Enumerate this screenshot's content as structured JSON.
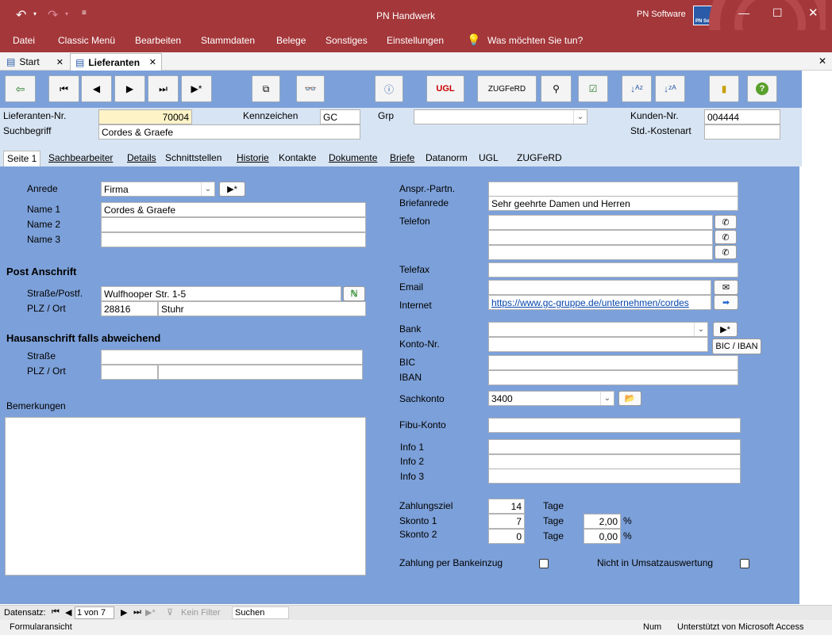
{
  "window": {
    "title": "PN Handwerk",
    "brand": "PN Software",
    "logo_text": "PN Soft"
  },
  "menu": [
    "Datei",
    "Classic Menü",
    "Bearbeiten",
    "Stammdaten",
    "Belege",
    "Sonstiges",
    "Einstellungen"
  ],
  "tell_me": "Was möchten Sie tun?",
  "doc_tabs": [
    {
      "label": "Start"
    },
    {
      "label": "Lieferanten"
    }
  ],
  "toolbar": {
    "ugl": "UGL",
    "zugferd": "ZUGFeRD"
  },
  "header": {
    "supplier_no_label": "Lieferanten-Nr.",
    "supplier_no": "70004",
    "search_label": "Suchbegriff",
    "search": "Cordes & Graefe",
    "code_label": "Kennzeichen",
    "code": "GC",
    "group_label": "Grp",
    "group": "",
    "customer_no_label": "Kunden-Nr.",
    "customer_no": "004444",
    "cost_type_label": "Std.-Kostenart",
    "cost_type": ""
  },
  "form_tabs": [
    "Seite 1",
    "Sachbearbeiter",
    "Details",
    "Schnittstellen",
    "Historie",
    "Kontakte",
    "Dokumente",
    "Briefe",
    "Datanorm",
    "UGL",
    "ZUGFeRD"
  ],
  "left": {
    "salutation_label": "Anrede",
    "salutation": "Firma",
    "name1_label": "Name 1",
    "name1": "Cordes & Graefe",
    "name2_label": "Name 2",
    "name2": "",
    "name3_label": "Name 3",
    "name3": "",
    "post_heading": "Post Anschrift",
    "street_label": "Straße/Postf.",
    "street": "Wulfhooper Str. 1-5",
    "zipcity_label": "PLZ / Ort",
    "zip": "28816",
    "city": "Stuhr",
    "house_heading": "Hausanschrift falls abweichend",
    "house_street_label": "Straße",
    "house_street": "",
    "house_zipcity_label": "PLZ / Ort",
    "house_zip": "",
    "house_city": "",
    "remarks_label": "Bemerkungen",
    "remarks": ""
  },
  "right": {
    "contact_label": "Anspr.-Partn.",
    "contact": "",
    "letter_label": "Briefanrede",
    "letter": "Sehr geehrte Damen und Herren",
    "phone_label": "Telefon",
    "phone1": "",
    "phone2": "",
    "phone3": "",
    "fax_label": "Telefax",
    "fax": "",
    "email_label": "Email",
    "email": "",
    "web_label": "Internet",
    "web": "https://www.gc-gruppe.de/unternehmen/cordes",
    "bank_label": "Bank",
    "bank": "",
    "account_label": "Konto-Nr.",
    "account": "",
    "bic_iban_button": "BIC / IBAN",
    "bic_label": "BIC",
    "bic": "",
    "iban_label": "IBAN",
    "iban": "",
    "ledger_label": "Sachkonto",
    "ledger": "3400",
    "fibu_label": "Fibu-Konto",
    "fibu": "",
    "info1_label": "Info 1",
    "info2_label": "Info 2",
    "info3_label": "Info 3",
    "info1": "",
    "info2": "",
    "info3": "",
    "terms_label": "Zahlungsziel",
    "terms": "14",
    "days": "Tage",
    "disc1_label": "Skonto 1",
    "disc1_days": "7",
    "disc1_pct": "2,00",
    "disc2_label": "Skonto 2",
    "disc2_days": "0",
    "disc2_pct": "0,00",
    "pct": "%",
    "debit_label": "Zahlung per Bankeinzug",
    "debit": false,
    "no_sales_label": "Nicht in Umsatzauswertung",
    "no_sales": false
  },
  "nav": {
    "record_label": "Datensatz:",
    "record": "1 von 7",
    "filter": "Kein Filter",
    "search": "Suchen"
  },
  "status": {
    "view": "Formularansicht",
    "num": "Num",
    "powered": "Unterstützt von Microsoft Access"
  }
}
